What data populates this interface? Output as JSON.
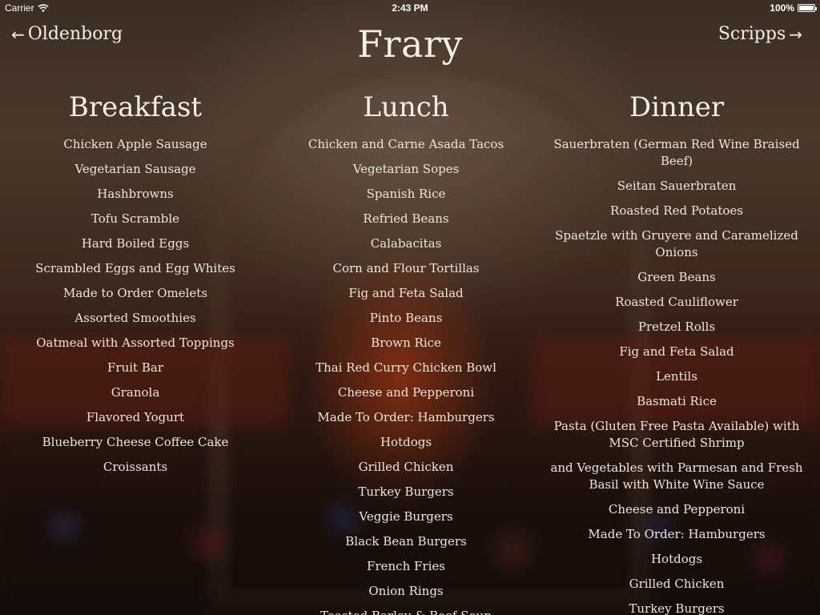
{
  "status_bar": {
    "carrier": "Carrier",
    "time": "2:43 PM",
    "battery": "100%",
    "battery_level": 1.0
  },
  "nav": {
    "prev_label": "Oldenborg",
    "next_label": "Scripps",
    "title": "Frary"
  },
  "meals": [
    {
      "heading": "Breakfast",
      "items": [
        "Chicken Apple Sausage",
        "Vegetarian Sausage",
        "Hashbrowns",
        "Tofu Scramble",
        "Hard Boiled Eggs",
        "Scrambled Eggs and Egg Whites",
        "Made to Order Omelets",
        "Assorted Smoothies",
        "Oatmeal with Assorted Toppings",
        "Fruit Bar",
        "Granola",
        "Flavored Yogurt",
        "Blueberry Cheese Coffee Cake",
        "Croissants"
      ]
    },
    {
      "heading": "Lunch",
      "items": [
        "Chicken and Carne Asada Tacos",
        "Vegetarian Sopes",
        "Spanish Rice",
        "Refried Beans",
        "Calabacitas",
        "Corn and Flour Tortillas",
        "Fig and Feta Salad",
        "Pinto Beans",
        "Brown Rice",
        "Thai Red Curry Chicken Bowl",
        "Cheese and Pepperoni",
        "Made To Order: Hamburgers",
        "Hotdogs",
        "Grilled Chicken",
        "Turkey Burgers",
        "Veggie Burgers",
        "Black Bean Burgers",
        "French Fries",
        "Onion Rings",
        "Toasted Barley & Beef Soup"
      ]
    },
    {
      "heading": "Dinner",
      "items": [
        "Sauerbraten (German Red Wine Braised Beef)",
        "Seitan Sauerbraten",
        "Roasted Red Potatoes",
        "Spaetzle with Gruyere and Caramelized Onions",
        "Green Beans",
        "Roasted Cauliflower",
        "Pretzel Rolls",
        "Fig and Feta Salad",
        "Lentils",
        "Basmati Rice",
        "Pasta (Gluten Free Pasta Available) with MSC Certified Shrimp",
        "and Vegetables with Parmesan and Fresh Basil with White Wine Sauce",
        "Cheese and Pepperoni",
        "Made To Order: Hamburgers",
        "Hotdogs",
        "Grilled Chicken",
        "Turkey Burgers"
      ]
    }
  ]
}
